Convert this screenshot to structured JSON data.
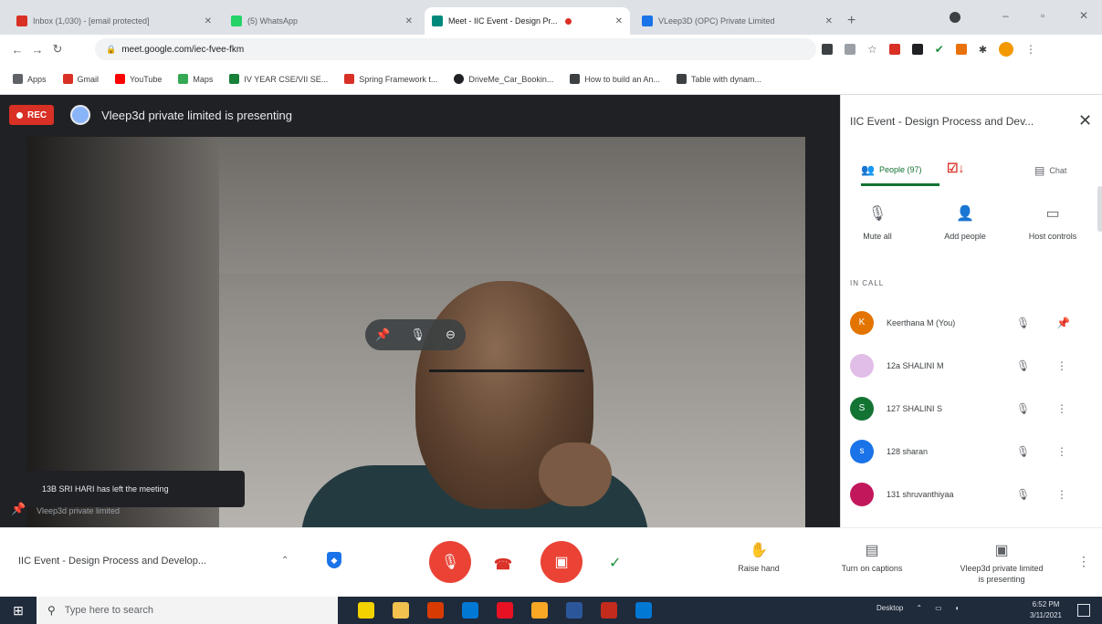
{
  "browser": {
    "tabs": [
      {
        "title": "Inbox (1,030) - [email protected]",
        "favicon_color": "#d93025",
        "active": false
      },
      {
        "title": "(5) WhatsApp",
        "favicon_color": "#25d366",
        "active": false
      },
      {
        "title": "Meet - IIC Event - Design Pr...",
        "favicon_color": "#00897b",
        "active": true,
        "recording": true
      },
      {
        "title": "VLeep3D (OPC) Private Limited",
        "favicon_color": "#1a73e8",
        "active": false
      }
    ],
    "new_tab": "+",
    "url": "meet.google.com/iec-fvee-fkm",
    "bookmarks": [
      {
        "label": "Apps",
        "color": "#5f6368"
      },
      {
        "label": "Gmail",
        "color": "#d93025"
      },
      {
        "label": "YouTube",
        "color": "#ff0000"
      },
      {
        "label": "Maps",
        "color": "#34a853"
      },
      {
        "label": "IV YEAR CSE/VII SE...",
        "color": "#188038"
      },
      {
        "label": "Spring Framework t...",
        "color": "#d93025"
      },
      {
        "label": "DriveMe_Car_Bookin...",
        "color": "#202124"
      },
      {
        "label": "How to build an An...",
        "color": "#3c4043"
      },
      {
        "label": "Table with dynam...",
        "color": "#3c4043"
      }
    ]
  },
  "meet": {
    "recording_label": "REC",
    "presenting_text": "Vleep3d private limited is presenting",
    "toast": "13B SRI HARI has left the meeting",
    "tile_name": "Vleep3d private limited",
    "panel": {
      "title": "IIC Event - Design Process and Dev...",
      "tabs": {
        "people": "People (97)",
        "chat": "Chat"
      },
      "host_actions": [
        {
          "label": "Mute all",
          "icon": "mic-off-icon"
        },
        {
          "label": "Add people",
          "icon": "add-person-icon"
        },
        {
          "label": "Host controls",
          "icon": "host-controls-icon"
        }
      ],
      "section_label": "IN CALL",
      "participants": [
        {
          "name": "Keerthana M (You)",
          "initial": "K",
          "color": "#e37400"
        },
        {
          "name": "12a SHALINI M",
          "initial": "",
          "color": "#e1bee7"
        },
        {
          "name": "127 SHALINI S",
          "initial": "S",
          "color": "#137333"
        },
        {
          "name": "128 sharan",
          "initial": "s",
          "color": "#1a73e8"
        },
        {
          "name": "131 shruvanthiyaa",
          "initial": "",
          "color": "#c2185b"
        }
      ]
    },
    "bottom": {
      "meeting_title": "IIC Event - Design Process and Develop...",
      "raise_hand": "Raise hand",
      "captions": "Turn on captions",
      "presenting_line1": "Vleep3d private limited",
      "presenting_line2": "is presenting"
    }
  },
  "taskbar": {
    "search_placeholder": "Type here to search",
    "desktop_label": "Desktop",
    "time": "6:52 PM",
    "date": "3/11/2021",
    "apps": [
      "#f3d200",
      "#f2c14e",
      "#d83b01",
      "#0078d4",
      "#e81123",
      "#f9a825",
      "#2b579a",
      "#c42b1c",
      "#0078d4"
    ]
  }
}
